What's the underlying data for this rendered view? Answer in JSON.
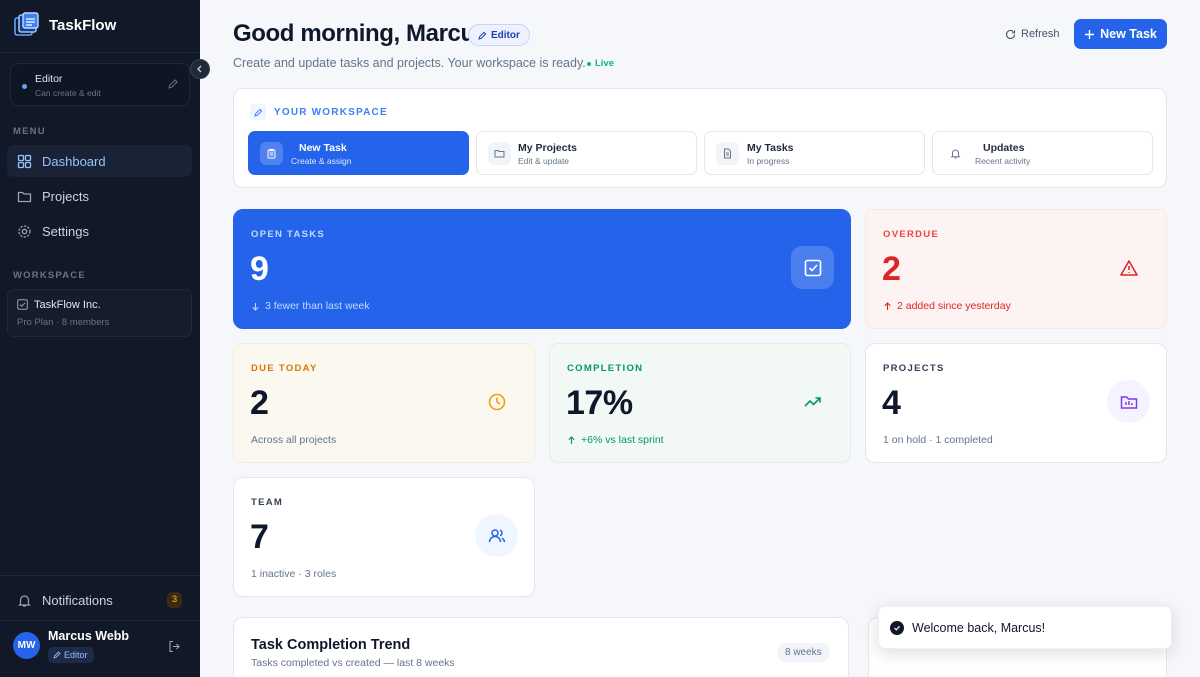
{
  "app": {
    "name": "TaskFlow"
  },
  "sidebar": {
    "role_card": {
      "title": "Editor",
      "subtitle": "Can create & edit"
    },
    "menu_heading": "MENU",
    "nav": [
      {
        "label": "Dashboard",
        "icon": "dashboard-icon",
        "active": true
      },
      {
        "label": "Projects",
        "icon": "folder-icon",
        "active": false
      },
      {
        "label": "Settings",
        "icon": "gear-icon",
        "active": false
      }
    ],
    "workspace_heading": "WORKSPACE",
    "workspace": {
      "name": "TaskFlow Inc.",
      "meta": "Pro Plan · 8 members"
    },
    "notifications": {
      "label": "Notifications",
      "count": "3"
    },
    "user": {
      "initials": "MW",
      "name": "Marcus Webb",
      "role": "Editor"
    }
  },
  "header": {
    "greeting": "Good morning, Marcus",
    "role_badge": "Editor",
    "subtitle": "Create and update tasks and projects. Your workspace is ready.",
    "live": "Live",
    "refresh_label": "Refresh",
    "new_task_label": "New Task"
  },
  "workspace_panel": {
    "title": "YOUR WORKSPACE",
    "actions": [
      {
        "label": "New Task",
        "sub": "Create & assign",
        "icon": "clipboard-icon"
      },
      {
        "label": "My Projects",
        "sub": "Edit & update",
        "icon": "folder-icon"
      },
      {
        "label": "My Tasks",
        "sub": "In progress",
        "icon": "document-icon"
      },
      {
        "label": "Updates",
        "sub": "Recent activity",
        "icon": "bell-icon"
      }
    ]
  },
  "stats": {
    "open_tasks": {
      "label": "OPEN TASKS",
      "value": "9",
      "foot": "3 fewer than last week"
    },
    "overdue": {
      "label": "OVERDUE",
      "value": "2",
      "foot": "2 added since yesterday"
    },
    "due_today": {
      "label": "DUE TODAY",
      "value": "2",
      "foot": "Across all projects"
    },
    "completion": {
      "label": "COMPLETION",
      "value": "17%",
      "foot": "+6% vs last sprint"
    },
    "projects": {
      "label": "PROJECTS",
      "value": "4",
      "foot": "1 on hold · 1 completed"
    },
    "team": {
      "label": "TEAM",
      "value": "7",
      "foot": "1 inactive · 3 roles"
    }
  },
  "trend": {
    "title": "Task Completion Trend",
    "subtitle": "Tasks completed vs created — last 8 weeks",
    "range": "8 weeks"
  },
  "toast": {
    "message": "Welcome back, Marcus!"
  },
  "colors": {
    "accent": "#2563eb",
    "sidebar": "#111827",
    "danger": "#dc2626",
    "success": "#059669",
    "warning": "#d97706"
  }
}
